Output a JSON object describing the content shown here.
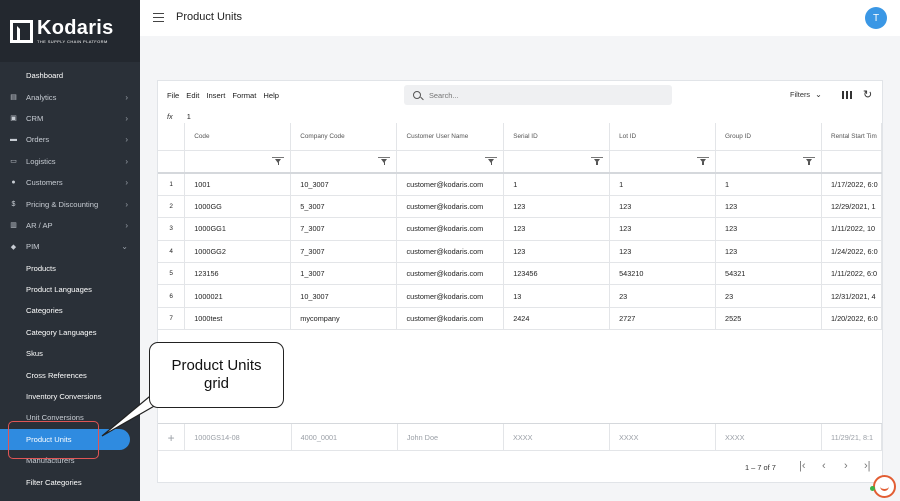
{
  "app": {
    "logo_name": "Kodaris",
    "logo_tagline": "THE SUPPLY CHAIN PLATFORM",
    "page_title": "Product Units",
    "avatar_initial": "T"
  },
  "sidebar": {
    "items": [
      {
        "label": "Dashboard",
        "icon": "none",
        "chevron": false
      },
      {
        "label": "Analytics",
        "icon": "chart-icon",
        "chevron": true
      },
      {
        "label": "CRM",
        "icon": "contact-card-icon",
        "chevron": true
      },
      {
        "label": "Orders",
        "icon": "truck-icon",
        "chevron": true
      },
      {
        "label": "Logistics",
        "icon": "shipping-icon",
        "chevron": true
      },
      {
        "label": "Customers",
        "icon": "users-icon",
        "chevron": true
      },
      {
        "label": "Pricing & Discounting",
        "icon": "dollar-icon",
        "chevron": true
      },
      {
        "label": "AR / AP",
        "icon": "bank-icon",
        "chevron": true
      },
      {
        "label": "PIM",
        "icon": "tag-icon",
        "chevron": true,
        "expanded": true
      }
    ],
    "pim_items": [
      "Products",
      "Product Languages",
      "Categories",
      "Category Languages",
      "Skus",
      "Cross References",
      "Inventory Conversions",
      "Unit Conversions",
      "Product Units",
      "Manufacturers",
      "Filter Categories"
    ],
    "active": "Product Units"
  },
  "toolbar": {
    "menu": [
      "File",
      "Edit",
      "Insert",
      "Format",
      "Help"
    ],
    "search_placeholder": "Search...",
    "filters_label": "Filters"
  },
  "formula_bar": {
    "fx": "fx",
    "value": "1"
  },
  "grid": {
    "columns": [
      "Code",
      "Company Code",
      "Customer User Name",
      "Serial ID",
      "Lot ID",
      "Group ID",
      "Rental Start Tim"
    ],
    "rows": [
      [
        "1",
        "1001",
        "10_3007",
        "customer@kodaris.com",
        "1",
        "1",
        "1",
        "1/17/2022, 6:0"
      ],
      [
        "2",
        "1000GG",
        "5_3007",
        "customer@kodaris.com",
        "123",
        "123",
        "123",
        "12/29/2021, 1"
      ],
      [
        "3",
        "1000GG1",
        "7_3007",
        "customer@kodaris.com",
        "123",
        "123",
        "123",
        "1/11/2022, 10"
      ],
      [
        "4",
        "1000GG2",
        "7_3007",
        "customer@kodaris.com",
        "123",
        "123",
        "123",
        "1/24/2022, 6:0"
      ],
      [
        "5",
        "123156",
        "1_3007",
        "customer@kodaris.com",
        "123456",
        "543210",
        "54321",
        "1/11/2022, 6:0"
      ],
      [
        "6",
        "1000021",
        "10_3007",
        "customer@kodaris.com",
        "13",
        "23",
        "23",
        "12/31/2021, 4"
      ],
      [
        "7",
        "1000test",
        "mycompany",
        "customer@kodaris.com",
        "2424",
        "2727",
        "2525",
        "1/20/2022, 6:0"
      ]
    ],
    "new_row": [
      "+",
      "1000GS14-08",
      "4000_0001",
      "John Doe",
      "XXXX",
      "XXXX",
      "XXXX",
      "11/29/21, 8:1"
    ]
  },
  "pager": {
    "count": "1 – 7 of 7"
  },
  "callout": {
    "line1": "Product Units",
    "line2": "grid"
  },
  "colors": {
    "sidebar_bg": "#2a3038",
    "accent": "#2f8be0",
    "callout_highlight": "#e05555",
    "chat": "#e25d33"
  }
}
